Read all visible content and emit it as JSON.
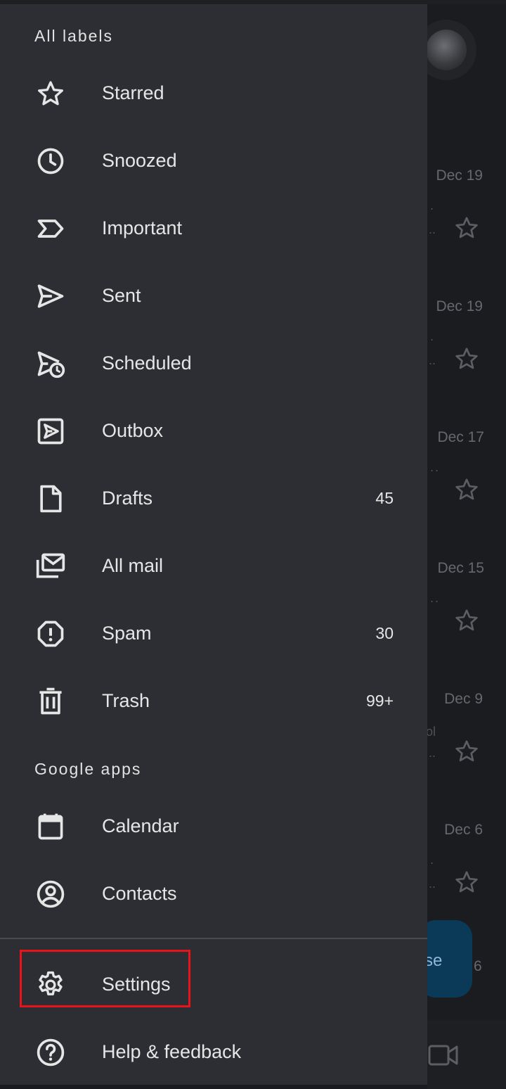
{
  "colors": {
    "drawer_bg": "#2d2e33",
    "text": "#e6e6e6",
    "highlight": "#e8141a",
    "compose": "#0b3a58"
  },
  "drawer": {
    "labels_title": "All labels",
    "labels": [
      {
        "icon": "star-icon",
        "label": "Starred",
        "count": ""
      },
      {
        "icon": "clock-icon",
        "label": "Snoozed",
        "count": ""
      },
      {
        "icon": "important-icon",
        "label": "Important",
        "count": ""
      },
      {
        "icon": "send-icon",
        "label": "Sent",
        "count": ""
      },
      {
        "icon": "scheduled-icon",
        "label": "Scheduled",
        "count": ""
      },
      {
        "icon": "outbox-icon",
        "label": "Outbox",
        "count": ""
      },
      {
        "icon": "draft-icon",
        "label": "Drafts",
        "count": "45"
      },
      {
        "icon": "all-mail-icon",
        "label": "All mail",
        "count": ""
      },
      {
        "icon": "spam-icon",
        "label": "Spam",
        "count": "30"
      },
      {
        "icon": "trash-icon",
        "label": "Trash",
        "count": "99+"
      }
    ],
    "apps_title": "Google apps",
    "apps": [
      {
        "icon": "calendar-icon",
        "label": "Calendar"
      },
      {
        "icon": "contacts-icon",
        "label": "Contacts"
      }
    ],
    "footer": [
      {
        "icon": "gear-icon",
        "label": "Settings"
      },
      {
        "icon": "help-icon",
        "label": "Help & feedback"
      }
    ]
  },
  "background": {
    "dates": [
      "Dec 19",
      "Dec 19",
      "Dec 17",
      "Dec 15",
      "Dec 9",
      "Dec 6"
    ],
    "compose_fragment": "se",
    "last_date_fragment": "6",
    "snippet_fragment": "ol"
  }
}
